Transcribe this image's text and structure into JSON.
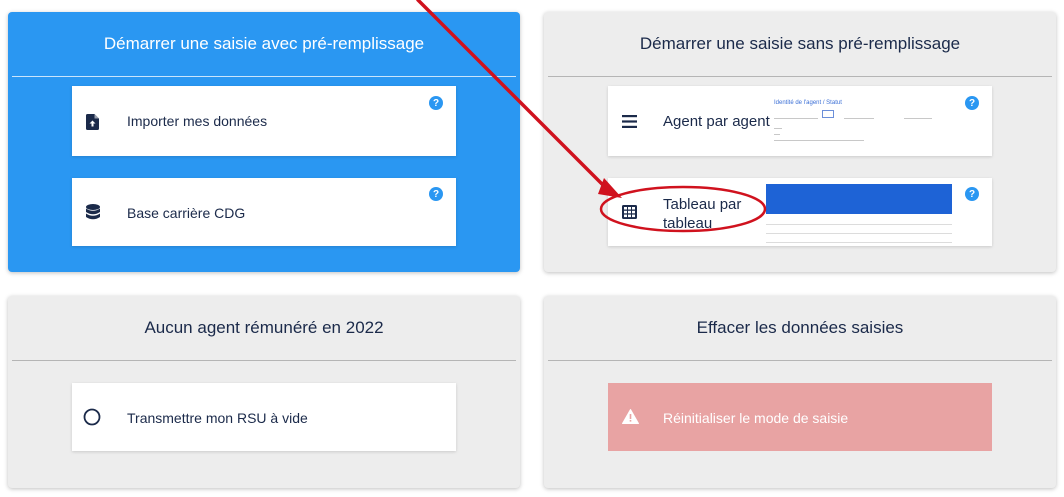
{
  "panels": {
    "prefill": {
      "title": "Démarrer une saisie avec pré-remplissage",
      "cards": [
        {
          "label": "Importer mes données",
          "icon": "file-upload-icon",
          "help": "?"
        },
        {
          "label": "Base carrière CDG",
          "icon": "database-icon",
          "help": "?"
        }
      ]
    },
    "noprefill": {
      "title": "Démarrer une saisie sans pré-remplissage",
      "cards": [
        {
          "label": "Agent par agent",
          "icon": "menu-lines-icon",
          "help": "?"
        },
        {
          "label": "Tableau par tableau",
          "icon": "table-grid-icon",
          "help": "?"
        }
      ],
      "form_preview_title": "Identité de l'agent / Statut"
    },
    "noagent": {
      "title": "Aucun agent rémunéré en 2022",
      "cards": [
        {
          "label": "Transmettre mon RSU à vide",
          "icon": "radio-circle-icon"
        }
      ]
    },
    "erase": {
      "title": "Effacer les données saisies",
      "reset_label": "Réinitialiser le mode de saisie",
      "reset_icon": "warning-icon"
    }
  },
  "colors": {
    "blue": "#2a97f2",
    "navy": "#1b2a4a",
    "grey_panel": "#ededed",
    "reset_bg": "#e8a3a3",
    "annotation_red": "#d0121e"
  }
}
